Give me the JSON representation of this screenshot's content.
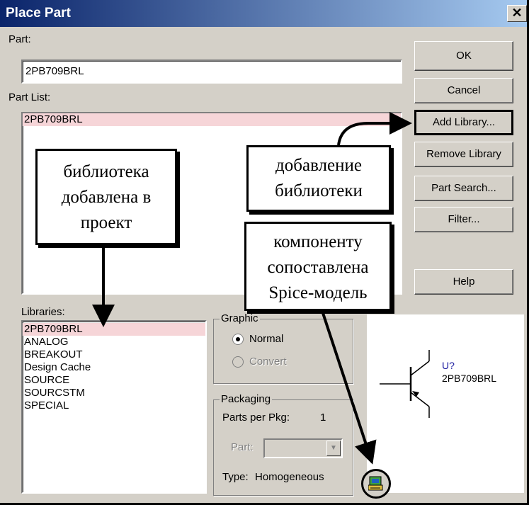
{
  "window": {
    "title": "Place Part"
  },
  "part": {
    "label": "Part:",
    "value": "2PB709BRL"
  },
  "part_list": {
    "label": "Part List:",
    "items": [
      "2PB709BRL"
    ]
  },
  "buttons": {
    "ok": "OK",
    "cancel": "Cancel",
    "add_library": "Add Library...",
    "remove_library": "Remove Library",
    "part_search": "Part Search...",
    "filter": "Filter...",
    "help": "Help"
  },
  "libraries": {
    "label": "Libraries:",
    "items": [
      "2PB709BRL",
      "ANALOG",
      "BREAKOUT",
      "Design Cache",
      "SOURCE",
      "SOURCSTM",
      "SPECIAL"
    ],
    "selected_index": 0
  },
  "graphic": {
    "label": "Graphic",
    "normal": "Normal",
    "convert": "Convert",
    "selected": "Normal"
  },
  "packaging": {
    "label": "Packaging",
    "parts_per_pkg_label": "Parts per Pkg:",
    "parts_per_pkg": "1",
    "part_label": "Part:",
    "type_label": "Type:",
    "type_value": "Homogeneous"
  },
  "preview": {
    "ref": "U?",
    "name": "2PB709BRL"
  },
  "callouts": {
    "library_added": [
      "библиотека",
      "добавлена в",
      "проект"
    ],
    "add_library": [
      "добавление",
      "библиотеки"
    ],
    "spice_model": [
      "компоненту",
      "сопоставлена",
      "Spice-модель"
    ]
  },
  "colors": {
    "selection": "#f6d5d8",
    "title_start": "#0a246a",
    "title_end": "#a6caf0",
    "dialog_bg": "#d4d0c8",
    "ref_color": "#1a1aa0"
  },
  "icons": [
    "close-icon",
    "transistor-symbol",
    "spice-model-icon",
    "dropdown-arrow-icon"
  ]
}
